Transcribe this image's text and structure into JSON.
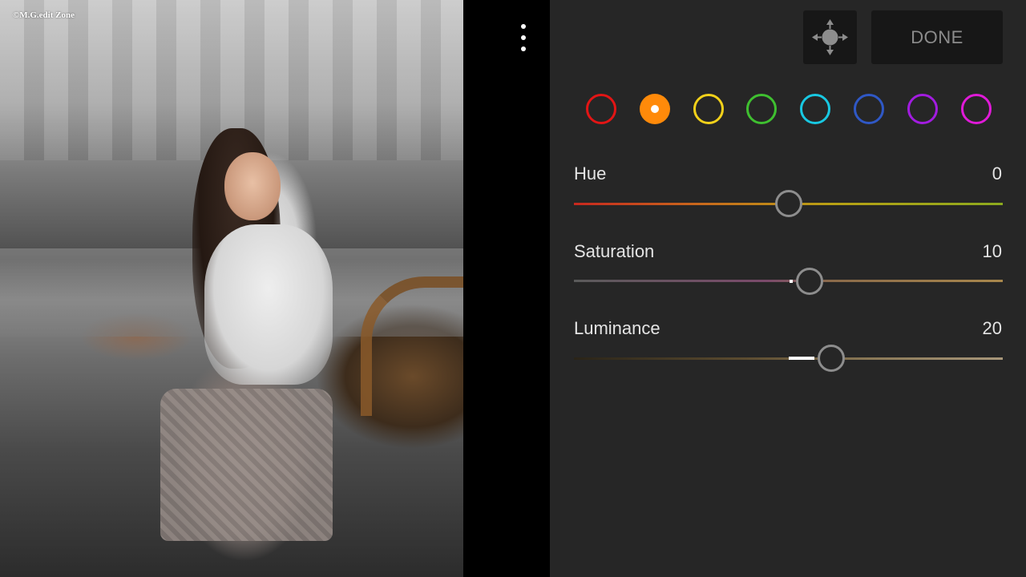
{
  "photo": {
    "watermark": "©M.G.edit Zone"
  },
  "toolbar": {
    "menu_icon": "kebab-menu-icon",
    "target_icon": "move-target-icon",
    "done_label": "DONE"
  },
  "color_swatches": [
    {
      "name": "red",
      "color": "#e31515",
      "selected": false
    },
    {
      "name": "orange",
      "color": "#ff8a0a",
      "selected": true
    },
    {
      "name": "yellow",
      "color": "#f2d11a",
      "selected": false
    },
    {
      "name": "green",
      "color": "#3fc030",
      "selected": false
    },
    {
      "name": "aqua",
      "color": "#18c8e2",
      "selected": false
    },
    {
      "name": "blue",
      "color": "#2f58c6",
      "selected": false
    },
    {
      "name": "purple",
      "color": "#a21ce0",
      "selected": false
    },
    {
      "name": "magenta",
      "color": "#e01ad8",
      "selected": false
    }
  ],
  "adjustments": {
    "hue": {
      "label": "Hue",
      "value": "0",
      "min": -100,
      "max": 100,
      "number": 0
    },
    "saturation": {
      "label": "Saturation",
      "value": "10",
      "min": -100,
      "max": 100,
      "number": 10
    },
    "luminance": {
      "label": "Luminance",
      "value": "20",
      "min": -100,
      "max": 100,
      "number": 20
    }
  }
}
